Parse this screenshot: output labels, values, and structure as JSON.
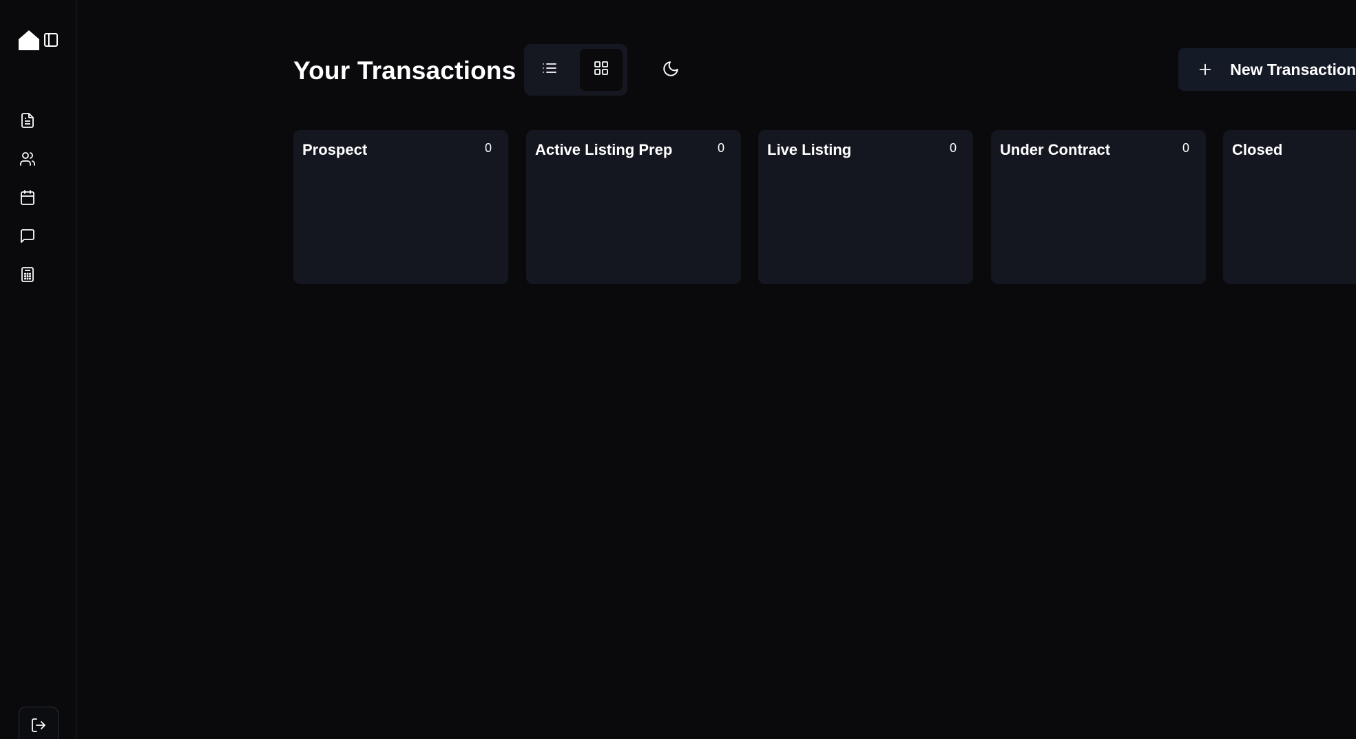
{
  "sidebar": {
    "icons": [
      "home-icon",
      "sidebar-toggle-icon",
      "document-icon",
      "users-icon",
      "calendar-icon",
      "chat-icon",
      "calculator-icon",
      "logout-icon"
    ]
  },
  "header": {
    "title": "Your Transactions",
    "new_button_label": "New Transaction"
  },
  "view_toggle": {
    "selected": "grid"
  },
  "columns": [
    {
      "title": "Prospect",
      "count": "0"
    },
    {
      "title": "Active Listing Prep",
      "count": "0"
    },
    {
      "title": "Live Listing",
      "count": "0"
    },
    {
      "title": "Under Contract",
      "count": "0"
    },
    {
      "title": "Closed",
      "count": ""
    }
  ],
  "colors": {
    "background": "#0a0a0d",
    "card": "#141720",
    "accent_button": "#151a27"
  }
}
